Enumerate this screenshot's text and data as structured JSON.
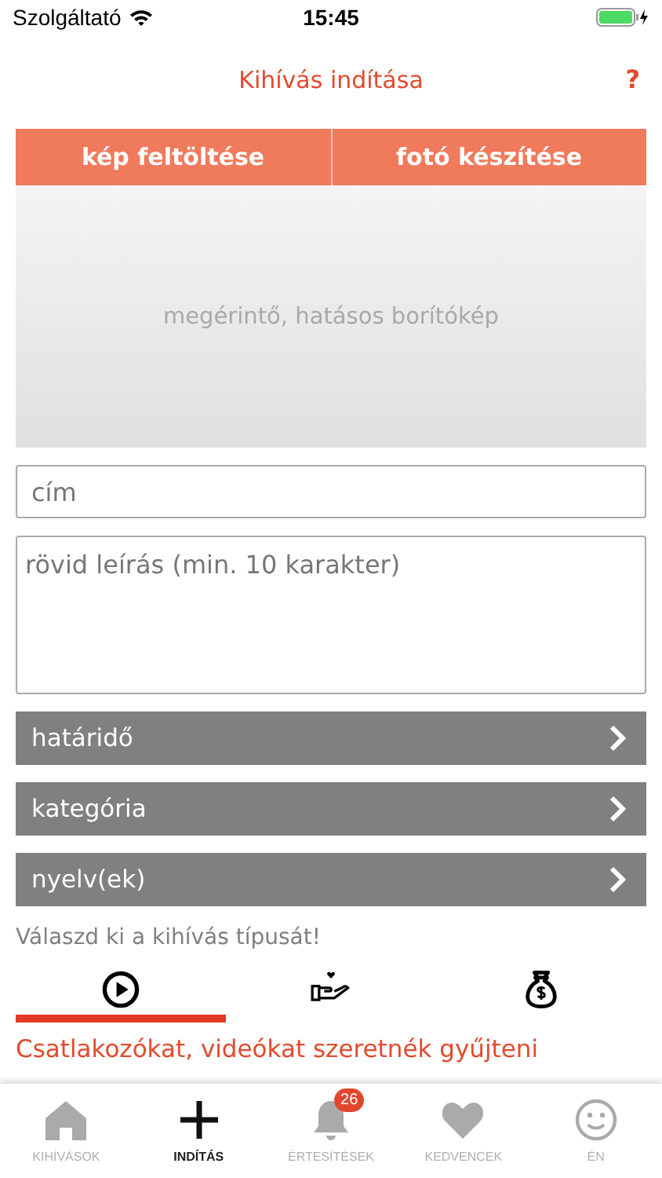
{
  "status_bar": {
    "carrier": "Szolgáltató",
    "time": "15:45"
  },
  "header": {
    "title": "Kihívás indítása",
    "help": "?"
  },
  "image_buttons": [
    "kép feltöltése",
    "fotó készítése"
  ],
  "cover": {
    "placeholder": "megérintő, hatásos borítókép"
  },
  "title_field": {
    "placeholder": "cím"
  },
  "description_field": {
    "placeholder": "rövid leírás (min. 10 karakter)"
  },
  "pickers": [
    "határidő",
    "kategória",
    "nyelv(ek)"
  ],
  "type_prompt": "Válaszd ki a kihívás típusát!",
  "types": [
    {
      "kind": "video",
      "selected": true
    },
    {
      "kind": "charity",
      "selected": false
    },
    {
      "kind": "money",
      "selected": false
    }
  ],
  "type_description": "Csatlakozókat, videókat szeretnék gyűjteni",
  "tab_bar": [
    {
      "kind": "home",
      "label": "KIHÍVÁSOK",
      "selected": false
    },
    {
      "kind": "plus",
      "label": "INDÍTÁS",
      "selected": true
    },
    {
      "kind": "bell",
      "label": "ÉRTESÍTÉSEK",
      "selected": false,
      "badge": "26"
    },
    {
      "kind": "heart",
      "label": "KEDVENCEK",
      "selected": false
    },
    {
      "kind": "smiley",
      "label": "ÉN",
      "selected": false
    }
  ]
}
